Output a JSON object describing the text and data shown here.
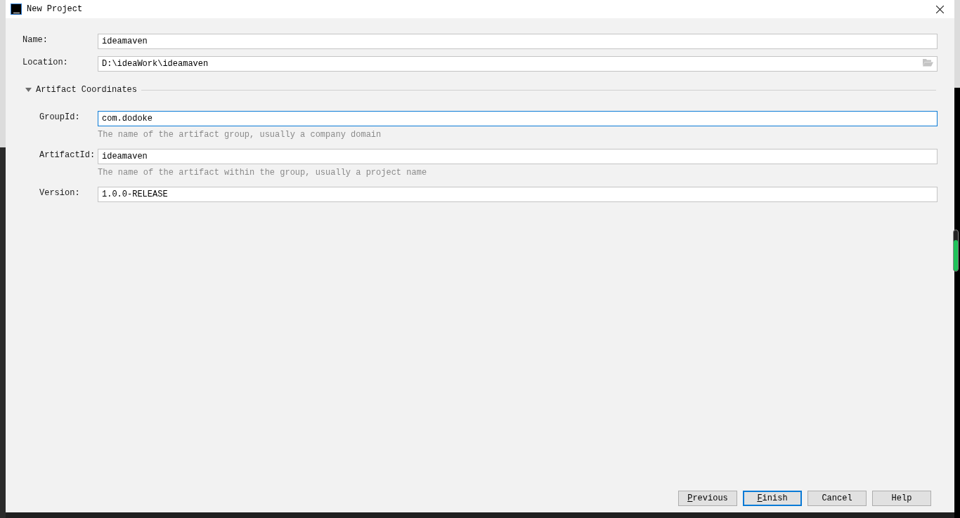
{
  "window": {
    "title": "New Project"
  },
  "fields": [
    {
      "label": "Name:",
      "value": "ideamaven",
      "focused": false,
      "browse": false
    },
    {
      "label": "Location:",
      "value": "D:\\ideaWork\\ideamaven",
      "focused": false,
      "browse": true
    }
  ],
  "section": {
    "title": "Artifact Coordinates",
    "expanded": true,
    "fields": [
      {
        "label": "GroupId:",
        "value": "com.dodoke",
        "focused": true,
        "hint": "The name of the artifact group, usually a company domain"
      },
      {
        "label": "ArtifactId:",
        "value": "ideamaven",
        "focused": false,
        "hint": "The name of the artifact within the group, usually a project name"
      },
      {
        "label": "Version:",
        "value": "1.0.0-RELEASE",
        "focused": false
      }
    ]
  },
  "buttons": [
    {
      "label": "Previous",
      "default": false,
      "mnemonic": true
    },
    {
      "label": "Finish",
      "default": true,
      "mnemonic": true
    },
    {
      "label": "Cancel",
      "default": false,
      "mnemonic": false
    },
    {
      "label": "Help",
      "default": false,
      "mnemonic": false
    }
  ]
}
